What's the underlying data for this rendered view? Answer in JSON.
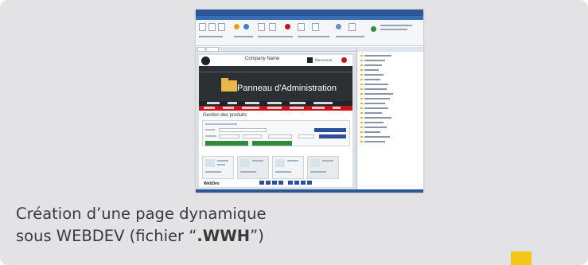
{
  "thumbnail": {
    "company_name": "Company Name",
    "hero_title": "Panneau d'Administration",
    "section_title": "Gestion des produits",
    "footer_logo": "WebDev",
    "user_link": "Bienvenue"
  },
  "caption": {
    "line1": "Création d’une page dynamique",
    "line2_prefix": "sous WEBDEV (fichier “",
    "line2_bold": ".WWH",
    "line2_suffix": "”)"
  },
  "colors": {
    "card": "#e3e3e5",
    "accent": "#f5c518",
    "hero": "#2c3034",
    "menu_red": "#c4161c",
    "ide_blue": "#2b5797"
  }
}
